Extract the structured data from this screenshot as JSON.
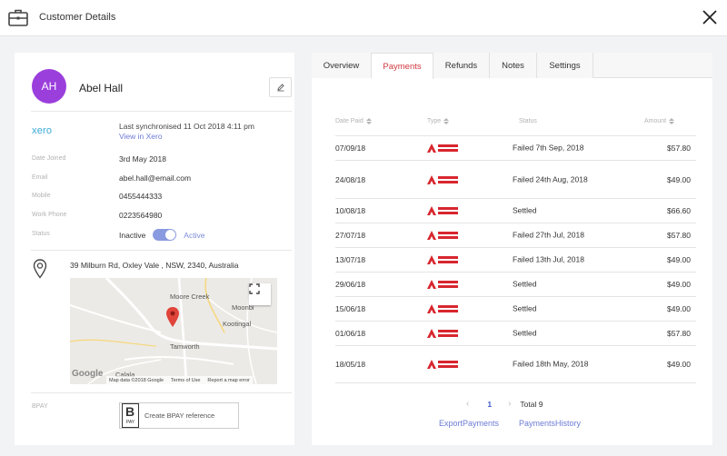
{
  "header": {
    "title": "Customer Details",
    "icons": {
      "left": "briefcase-icon",
      "right": "close-icon"
    }
  },
  "customer": {
    "initials": "AH",
    "name": "Abel Hall",
    "avatar_color": "#9b3fdc"
  },
  "xero": {
    "logo_text": "xero",
    "sync_text": "Last synchronised 11 Oct 2018 4:11 pm",
    "link": "View in Xero"
  },
  "details": {
    "date_joined_label": "Date Joined",
    "date_joined": "3rd May 2018",
    "email_label": "Email",
    "email": "abel.hall@email.com",
    "mobile_label": "Mobile",
    "mobile": "0455444333",
    "work_phone_label": "Work Phone",
    "work_phone": "0223564980",
    "status_label": "Status",
    "status_inactive": "Inactive",
    "status_active": "Active"
  },
  "address": "39 Milburn Rd, Oxley Vale , NSW, 2340, Australia",
  "map": {
    "places": [
      "Moore Creek",
      "Moonbi",
      "Kootingal",
      "Tamworth",
      "Calala"
    ],
    "google": "Google",
    "data_credit": "Map data ©2018 Google",
    "terms": "Terms of Use",
    "report": "Report a map error"
  },
  "bpay": {
    "label": "BPAY",
    "logo": "PAY",
    "button": "Create BPAY reference"
  },
  "tabs": [
    "Overview",
    "Payments",
    "Refunds",
    "Notes",
    "Settings"
  ],
  "active_tab": "Payments",
  "table": {
    "headers": [
      "Date Paid",
      "Type",
      "Status",
      "Amount"
    ],
    "rows": [
      {
        "date": "07/09/18",
        "status": "Failed 7th Sep, 2018",
        "amount": "$57.80"
      },
      {
        "date": "24/08/18",
        "status": "Failed 24th Aug, 2018",
        "amount": "$49.00"
      },
      {
        "date": "10/08/18",
        "status": "Settled",
        "amount": "$66.60"
      },
      {
        "date": "27/07/18",
        "status": "Failed 27th Jul, 2018",
        "amount": "$57.80"
      },
      {
        "date": "13/07/18",
        "status": "Failed 13th Jul, 2018",
        "amount": "$49.00"
      },
      {
        "date": "29/06/18",
        "status": "Settled",
        "amount": "$49.00"
      },
      {
        "date": "15/06/18",
        "status": "Settled",
        "amount": "$49.00"
      },
      {
        "date": "01/06/18",
        "status": "Settled",
        "amount": "$57.80"
      },
      {
        "date": "18/05/18",
        "status": "Failed 18th May, 2018",
        "amount": "$49.00"
      }
    ],
    "type_icon": "direct-debit-icon",
    "type_color": "#d8262e"
  },
  "pager": {
    "prev": "‹",
    "page": "1",
    "next": "›",
    "total": "Total 9"
  },
  "links": {
    "export": "ExportPayments",
    "history": "PaymentsHistory"
  },
  "colors": {
    "accent": "#6b7bd6",
    "active_tab": "#d2373f",
    "toggle": "#8a9ae0"
  }
}
